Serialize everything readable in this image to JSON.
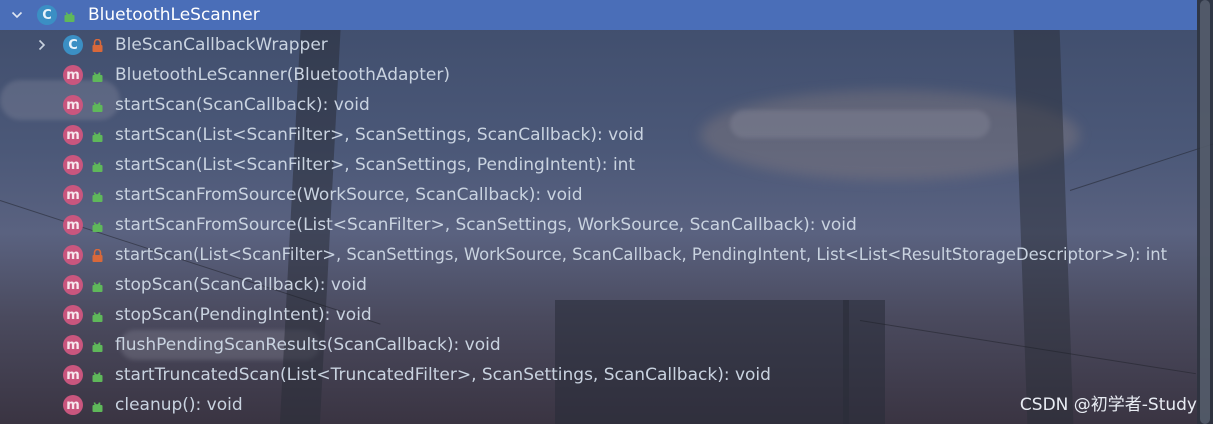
{
  "tree": {
    "root": {
      "label": "BluetoothLeScanner",
      "badge": "C",
      "badge_kind": "class",
      "access": "public",
      "expanded": true,
      "selected": true
    },
    "items": [
      {
        "label": "BleScanCallbackWrapper",
        "badge": "C",
        "badge_kind": "class",
        "access": "private",
        "collapsed": true
      },
      {
        "label": "BluetoothLeScanner(BluetoothAdapter)",
        "badge": "m",
        "badge_kind": "method",
        "access": "public"
      },
      {
        "label": "startScan(ScanCallback): void",
        "badge": "m",
        "badge_kind": "method",
        "access": "public"
      },
      {
        "label": "startScan(List<ScanFilter>, ScanSettings, ScanCallback): void",
        "badge": "m",
        "badge_kind": "method",
        "access": "public"
      },
      {
        "label": "startScan(List<ScanFilter>, ScanSettings, PendingIntent): int",
        "badge": "m",
        "badge_kind": "method",
        "access": "public"
      },
      {
        "label": "startScanFromSource(WorkSource, ScanCallback): void",
        "badge": "m",
        "badge_kind": "method",
        "access": "public"
      },
      {
        "label": "startScanFromSource(List<ScanFilter>, ScanSettings, WorkSource, ScanCallback): void",
        "badge": "m",
        "badge_kind": "method",
        "access": "public"
      },
      {
        "label": "startScan(List<ScanFilter>, ScanSettings, WorkSource, ScanCallback, PendingIntent, List<List<ResultStorageDescriptor>>): int",
        "badge": "m",
        "badge_kind": "method",
        "access": "private"
      },
      {
        "label": "stopScan(ScanCallback): void",
        "badge": "m",
        "badge_kind": "method",
        "access": "public"
      },
      {
        "label": "stopScan(PendingIntent): void",
        "badge": "m",
        "badge_kind": "method",
        "access": "public"
      },
      {
        "label": "flushPendingScanResults(ScanCallback): void",
        "badge": "m",
        "badge_kind": "method",
        "access": "public"
      },
      {
        "label": "startTruncatedScan(List<TruncatedFilter>, ScanSettings, ScanCallback): void",
        "badge": "m",
        "badge_kind": "method",
        "access": "public"
      },
      {
        "label": "cleanup(): void",
        "badge": "m",
        "badge_kind": "method",
        "access": "public"
      }
    ]
  },
  "watermark": "CSDN @初学者-Study",
  "colors": {
    "selection": "#4a6eb8",
    "class_badge": "#3b8fc4",
    "method_badge": "#c9567e",
    "public_lock": "#5fb85a",
    "private_lock": "#d9683a"
  },
  "icons": {
    "expanded_arrow": "chevron-down-icon",
    "collapsed_arrow": "chevron-right-icon",
    "public": "unlocked-padlock-icon",
    "private": "locked-padlock-icon"
  }
}
